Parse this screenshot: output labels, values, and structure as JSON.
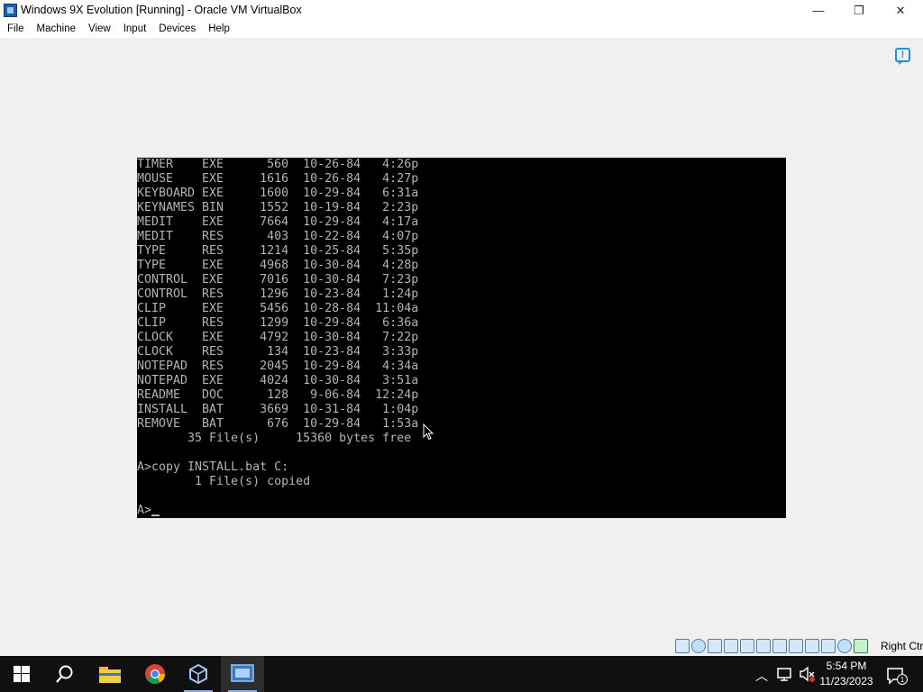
{
  "window": {
    "title": "Windows 9X Evolution [Running] - Oracle VM VirtualBox",
    "min_glyph": "—",
    "max_glyph": "❐",
    "close_glyph": "✕"
  },
  "menu": [
    "File",
    "Machine",
    "View",
    "Input",
    "Devices",
    "Help"
  ],
  "dos": {
    "listing": [
      {
        "name": "TIMER",
        "ext": "EXE",
        "size": "560",
        "date": "10-26-84",
        "time": "4:26p"
      },
      {
        "name": "MOUSE",
        "ext": "EXE",
        "size": "1616",
        "date": "10-26-84",
        "time": "4:27p"
      },
      {
        "name": "KEYBOARD",
        "ext": "EXE",
        "size": "1600",
        "date": "10-29-84",
        "time": "6:31a"
      },
      {
        "name": "KEYNAMES",
        "ext": "BIN",
        "size": "1552",
        "date": "10-19-84",
        "time": "2:23p"
      },
      {
        "name": "MEDIT",
        "ext": "EXE",
        "size": "7664",
        "date": "10-29-84",
        "time": "4:17a"
      },
      {
        "name": "MEDIT",
        "ext": "RES",
        "size": "403",
        "date": "10-22-84",
        "time": "4:07p"
      },
      {
        "name": "TYPE",
        "ext": "RES",
        "size": "1214",
        "date": "10-25-84",
        "time": "5:35p"
      },
      {
        "name": "TYPE",
        "ext": "EXE",
        "size": "4968",
        "date": "10-30-84",
        "time": "4:28p"
      },
      {
        "name": "CONTROL",
        "ext": "EXE",
        "size": "7016",
        "date": "10-30-84",
        "time": "7:23p"
      },
      {
        "name": "CONTROL",
        "ext": "RES",
        "size": "1296",
        "date": "10-23-84",
        "time": "1:24p"
      },
      {
        "name": "CLIP",
        "ext": "EXE",
        "size": "5456",
        "date": "10-28-84",
        "time": "11:04a"
      },
      {
        "name": "CLIP",
        "ext": "RES",
        "size": "1299",
        "date": "10-29-84",
        "time": "6:36a"
      },
      {
        "name": "CLOCK",
        "ext": "EXE",
        "size": "4792",
        "date": "10-30-84",
        "time": "7:22p"
      },
      {
        "name": "CLOCK",
        "ext": "RES",
        "size": "134",
        "date": "10-23-84",
        "time": "3:33p"
      },
      {
        "name": "NOTEPAD",
        "ext": "RES",
        "size": "2045",
        "date": "10-29-84",
        "time": "4:34a"
      },
      {
        "name": "NOTEPAD",
        "ext": "EXE",
        "size": "4024",
        "date": "10-30-84",
        "time": "3:51a"
      },
      {
        "name": "README",
        "ext": "DOC",
        "size": "128",
        "date": "9-06-84",
        "time": "12:24p"
      },
      {
        "name": "INSTALL",
        "ext": "BAT",
        "size": "3669",
        "date": "10-31-84",
        "time": "1:04p"
      },
      {
        "name": "REMOVE",
        "ext": "BAT",
        "size": "676",
        "date": "10-29-84",
        "time": "1:53a"
      }
    ],
    "summary": "       35 File(s)     15360 bytes free",
    "command": "A>copy INSTALL.bat C:",
    "copied": "        1 File(s) copied",
    "prompt": "A>"
  },
  "statusbar": {
    "host_key": "Right Ctrl",
    "icons": [
      "hard-disk-icon",
      "optical-drive-icon",
      "floppy-icon",
      "audio-icon",
      "network-icon",
      "usb-icon",
      "shared-folders-icon",
      "display-icon",
      "video-capture-icon",
      "recording-icon",
      "cpu-icon",
      "mouse-integration-icon",
      "keyboard-capture-icon"
    ]
  },
  "taskbar": {
    "apps": [
      "start-button",
      "search-button",
      "file-explorer-icon",
      "chrome-icon",
      "virtualbox-manager-icon",
      "virtual-machine-icon"
    ],
    "tray_chevron": "︿",
    "time": "5:54 PM",
    "date": "11/23/2023",
    "notification_count": "1"
  }
}
